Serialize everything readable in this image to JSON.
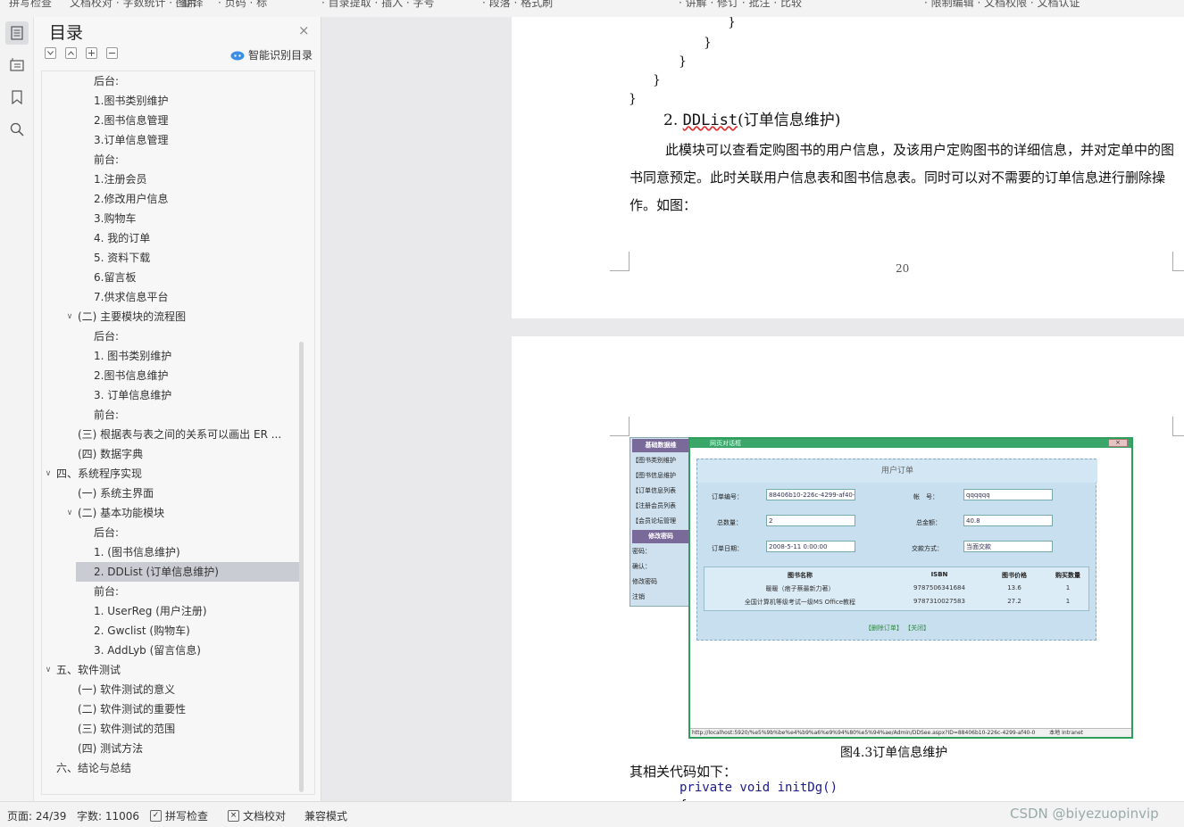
{
  "topbar": {
    "fragments": [
      "拼写检查",
      "文档校对 · 字数统计 · 图片",
      "· 翻译",
      "· 页码 ·  标",
      "· 目录提取 · 插入 · 字号",
      "· 段落 · 格式刷",
      "· 讲解 · 修订 · 批注 · 比较",
      "· 限制编辑 · 文档权限 · 文档认证"
    ]
  },
  "toc": {
    "title": "目录",
    "close": "×",
    "smart_label": "智能识别目录",
    "items": [
      {
        "text": "后台:",
        "indent": 2,
        "chev": ""
      },
      {
        "text": "1.图书类别维护",
        "indent": 2,
        "chev": ""
      },
      {
        "text": "2.图书信息管理",
        "indent": 2,
        "chev": ""
      },
      {
        "text": "3.订单信息管理",
        "indent": 2,
        "chev": ""
      },
      {
        "text": "前台:",
        "indent": 2,
        "chev": ""
      },
      {
        "text": "1.注册会员",
        "indent": 2,
        "chev": ""
      },
      {
        "text": "2.修改用户信息",
        "indent": 2,
        "chev": ""
      },
      {
        "text": "3.购物车",
        "indent": 2,
        "chev": ""
      },
      {
        "text": "4. 我的订单",
        "indent": 2,
        "chev": ""
      },
      {
        "text": "5. 资料下载",
        "indent": 2,
        "chev": ""
      },
      {
        "text": "6.留言板",
        "indent": 2,
        "chev": ""
      },
      {
        "text": "7.供求信息平台",
        "indent": 2,
        "chev": ""
      },
      {
        "text": "(二) 主要模块的流程图",
        "indent": 1,
        "chev": "∨"
      },
      {
        "text": "后台:",
        "indent": 2,
        "chev": ""
      },
      {
        "text": "1. 图书类别维护",
        "indent": 2,
        "chev": ""
      },
      {
        "text": "2.图书信息维护",
        "indent": 2,
        "chev": ""
      },
      {
        "text": "3. 订单信息维护",
        "indent": 2,
        "chev": ""
      },
      {
        "text": "前台:",
        "indent": 2,
        "chev": ""
      },
      {
        "text": "(三) 根据表与表之间的关系可以画出 ER ...",
        "indent": 1,
        "chev": ""
      },
      {
        "text": "(四) 数据字典",
        "indent": 1,
        "chev": ""
      },
      {
        "text": "四、系统程序实现",
        "indent": 0,
        "chev": "∨"
      },
      {
        "text": "(一) 系统主界面",
        "indent": 1,
        "chev": ""
      },
      {
        "text": "(二) 基本功能模块",
        "indent": 1,
        "chev": "∨"
      },
      {
        "text": "后台:",
        "indent": 2,
        "chev": ""
      },
      {
        "text": "1. (图书信息维护)",
        "indent": 2,
        "chev": ""
      },
      {
        "text": "2. DDList (订单信息维护)",
        "indent": 2,
        "chev": "",
        "selected": true
      },
      {
        "text": "前台:",
        "indent": 2,
        "chev": ""
      },
      {
        "text": "1. UserReg (用户注册)",
        "indent": 2,
        "chev": ""
      },
      {
        "text": "2. Gwclist (购物车)",
        "indent": 2,
        "chev": ""
      },
      {
        "text": "3. AddLyb (留言信息)",
        "indent": 2,
        "chev": ""
      },
      {
        "text": "五、软件测试",
        "indent": 0,
        "chev": "∨"
      },
      {
        "text": "(一)  软件测试的意义",
        "indent": 1,
        "chev": ""
      },
      {
        "text": "(二) 软件测试的重要性",
        "indent": 1,
        "chev": ""
      },
      {
        "text": "(三) 软件测试的范围",
        "indent": 1,
        "chev": ""
      },
      {
        "text": "(四) 测试方法",
        "indent": 1,
        "chev": ""
      },
      {
        "text": "六、结论与总结",
        "indent": 0,
        "chev": ""
      }
    ]
  },
  "doc": {
    "braces": [
      "}",
      "}",
      "}",
      "}",
      "}"
    ],
    "heading_num": "2.",
    "heading_code": "DDList",
    "heading_rest": "(订单信息维护)",
    "paragraph": "此模块可以查看定购图书的用户信息，及该用户定购图书的详细信息，并对定单中的图书同意预定。此时关联用户信息表和图书信息表。同时可以对不需要的订单信息进行删除操作。如图：",
    "page_number": "20",
    "caption": "图4.3订单信息维护",
    "related_code": "其相关代码如下：",
    "code_line": "private void initDg()",
    "code_next": "{"
  },
  "screenshot": {
    "left_menu": [
      {
        "text": "基础数据维",
        "header": true
      },
      {
        "text": "【图书类别维护",
        "header": false
      },
      {
        "text": "【图书信息维护",
        "header": false
      },
      {
        "text": "【订单信息列表",
        "header": false
      },
      {
        "text": "【注册会员列表",
        "header": false
      },
      {
        "text": "【会员论坛管理",
        "header": false
      },
      {
        "text": "修改密码",
        "header": true
      },
      {
        "text": "密码：",
        "header": false
      },
      {
        "text": "确认：",
        "header": false
      },
      {
        "text": "修改密码",
        "header": false
      },
      {
        "text": "注销",
        "header": false
      }
    ],
    "window_title": "网页对话框",
    "form_title": "用户订单",
    "fields": {
      "order_no_label": "订单编号：",
      "order_no": "88406b10-226c-4299-af40-0",
      "account_label": "帐　号：",
      "account": "qqqqqq",
      "qty_label": "总数量：",
      "qty": "2",
      "amount_label": "总金额：",
      "amount": "40.8",
      "date_label": "订单日期：",
      "date": "2008-5-11 0:00:00",
      "pay_label": "交款方式：",
      "pay": "当面交款"
    },
    "table": {
      "headers": [
        "图书名称",
        "ISBN",
        "图书价格",
        "购买数量"
      ],
      "rows": [
        [
          "暖暖（痞子蔡最新力著）",
          "9787506341684",
          "13.6",
          "1"
        ],
        [
          "全国计算机等级考试一级MS Office教程",
          "9787310027583",
          "27.2",
          "1"
        ]
      ]
    },
    "links": "【删除订单】 【关闭】",
    "statusline": "http://localhost:5920/%e5%9b%be%e4%b9%a6%e9%94%80%e5%94%ae/Admin/DDSee.aspx?ID=88406b10-226c-4299-af40-0",
    "zone": "本地 Intranet"
  },
  "statusbar": {
    "page": "页面: 24/39",
    "words": "字数: 11006",
    "spell": "拼写检查",
    "proof": "文档校对",
    "compat": "兼容模式",
    "watermark": "CSDN @biyezuopinvip"
  }
}
